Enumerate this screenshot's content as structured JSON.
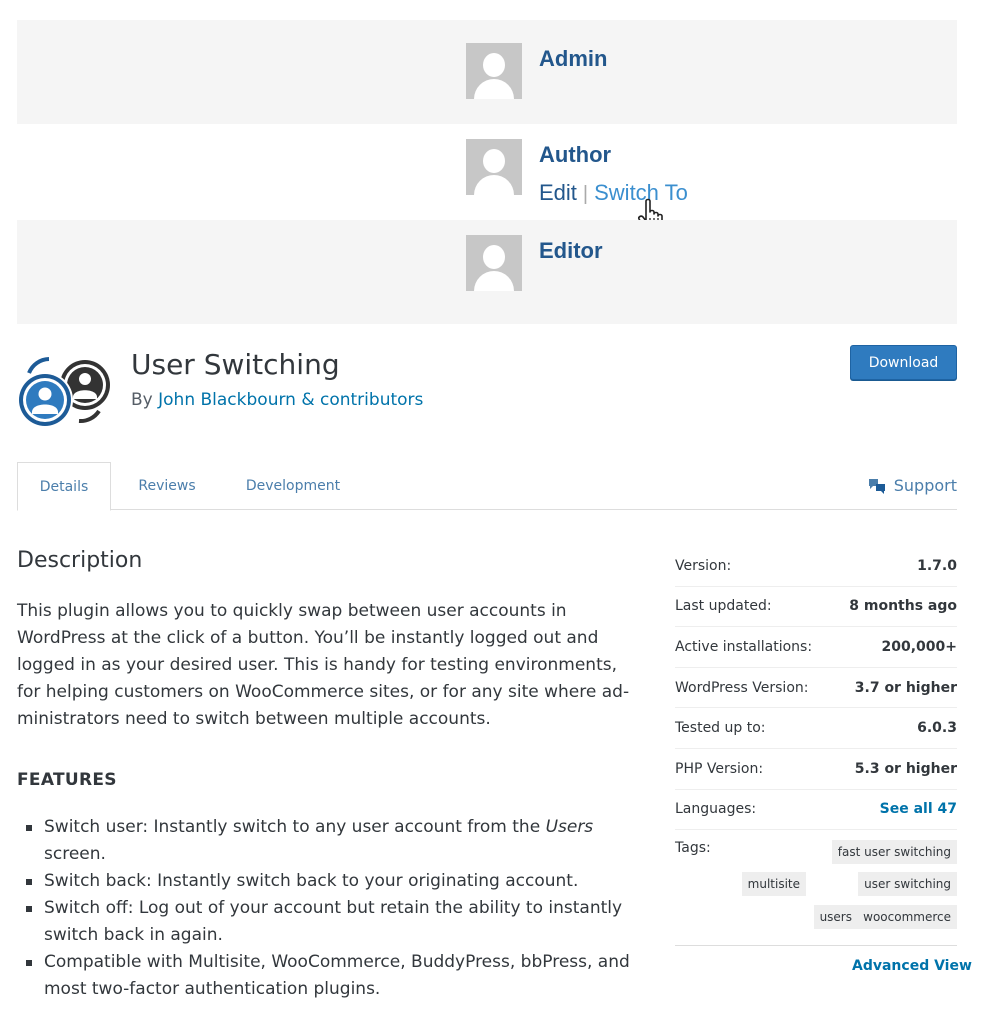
{
  "banner": {
    "users": [
      {
        "name": "Admin"
      },
      {
        "name": "Author",
        "actions": {
          "edit": "Edit",
          "separator": "|",
          "switch_to": "Switch To"
        }
      },
      {
        "name": "Editor"
      }
    ]
  },
  "plugin": {
    "title": "User Switching",
    "by_prefix": "By",
    "author": "John Blackbourn & contributors",
    "download_label": "Download"
  },
  "tabs": [
    "Details",
    "Reviews",
    "Development"
  ],
  "support_label": "Support",
  "description": {
    "heading": "Description",
    "paragraph": "This plugin allows you to quickly swap between user accounts in WordPress at the click of a button. You’ll be instantly logged out and logged in as your desired user. This is handy for testing environments, for helping customers on WooCommerce sites, or for any site where ad­ministrators need to switch between multiple accounts.",
    "features_heading": "FEATURES",
    "features": [
      {
        "pre": "Switch user: Instantly switch to any user account from the ",
        "em": "Users",
        "post": " screen."
      },
      {
        "pre": "Switch back: Instantly switch back to your originating account.",
        "em": "",
        "post": ""
      },
      {
        "pre": "Switch off: Log out of your account but retain the ability to instantly switch back in again.",
        "em": "",
        "post": ""
      },
      {
        "pre": "Compatible with Multisite, WooCommerce, BuddyPress, bbPress, and most two-factor authentication plugins.",
        "em": "",
        "post": ""
      }
    ]
  },
  "meta": {
    "rows": [
      {
        "label": "Version:",
        "value": "1.7.0"
      },
      {
        "label": "Last updated:",
        "value": "8 months ago"
      },
      {
        "label": "Active installations:",
        "value": "200,000+"
      },
      {
        "label": "WordPress Version:",
        "value": "3.7 or higher"
      },
      {
        "label": "Tested up to:",
        "value": "6.0.3"
      },
      {
        "label": "PHP Version:",
        "value": "5.3 or higher"
      },
      {
        "label": "Languages:",
        "value": "See all 47"
      }
    ],
    "tags_label": "Tags:",
    "tags": [
      "fast user switching",
      "multisite",
      "user switching",
      "users",
      "woocommerce"
    ],
    "advanced_view": "Advanced View"
  },
  "colors": {
    "link": "#0073aa",
    "button": "#2f7bbf",
    "banner_text": "#23578c"
  },
  "icons": [
    "avatar-icon",
    "cursor-hand-icon",
    "plugin-icon",
    "support-icon"
  ]
}
